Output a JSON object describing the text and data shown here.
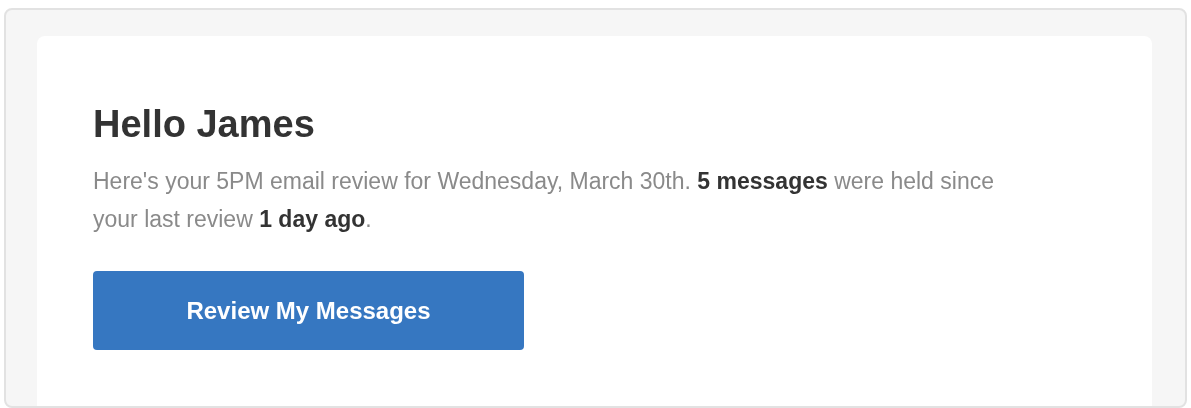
{
  "greeting": "Hello James",
  "message": "Here's your 5PM email review for Wednesday, March 30th. **5 messages** were held since your last review **1 day ago**.",
  "button": "Review My Messages"
}
